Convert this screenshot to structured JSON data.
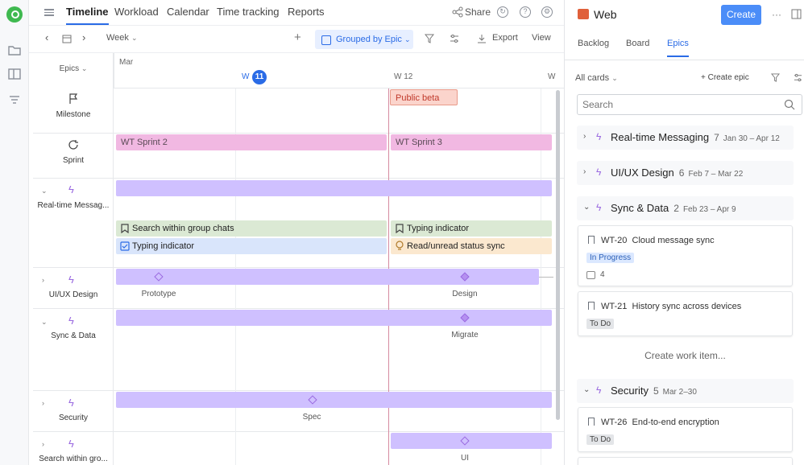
{
  "nav": {
    "tabs": [
      "Timeline",
      "Workload",
      "Calendar",
      "Time tracking",
      "Reports"
    ],
    "active_tab": "Timeline",
    "share": "Share"
  },
  "toolbar": {
    "range": "Week",
    "grouped": "Grouped by Epic",
    "export": "Export",
    "view": "View"
  },
  "timeline": {
    "group_header": "Epics",
    "month": "Mar",
    "weeks": [
      {
        "label": "W",
        "badge": "11"
      },
      {
        "label": "W 12"
      },
      {
        "label": "W"
      }
    ],
    "rows": [
      {
        "label": "Milestone",
        "icon": "flag-icon"
      },
      {
        "label": "Sprint",
        "icon": "sprint-icon"
      },
      {
        "label": "Real-time Messag...",
        "icon": "bolt-icon"
      },
      {
        "label": "UI/UX Design",
        "icon": "bolt-icon"
      },
      {
        "label": "Sync & Data",
        "icon": "bolt-icon"
      },
      {
        "label": "Security",
        "icon": "bolt-icon"
      },
      {
        "label": "Search within gro...",
        "icon": "bolt-icon"
      }
    ],
    "milestone": "Public beta",
    "sprints": [
      "WT Sprint 2",
      "WT Sprint 3"
    ],
    "cards": [
      {
        "title": "Search within group chats",
        "color": "#dbe9d4"
      },
      {
        "title": "Typing indicator",
        "color": "#dbe9d4"
      },
      {
        "title": "Typing indicator",
        "color": "#d9e5fb"
      },
      {
        "title": "Read/unread status sync",
        "color": "#fbe8cf"
      }
    ],
    "markers": [
      "Prototype",
      "Design",
      "Migrate",
      "Spec",
      "UI"
    ]
  },
  "panel": {
    "title": "Web",
    "create": "Create",
    "tabs": [
      "Backlog",
      "Board",
      "Epics"
    ],
    "active_tab": "Epics",
    "filter": "All cards",
    "create_epic": "Create epic",
    "search_placeholder": "Search",
    "groups": [
      {
        "name": "Real-time Messaging",
        "count": "7",
        "dates": "Jan 30 – Apr 12"
      },
      {
        "name": "UI/UX Design",
        "count": "6",
        "dates": "Feb 7 – Mar 22"
      },
      {
        "name": "Sync & Data",
        "count": "2",
        "dates": "Feb 23 – Apr 9"
      },
      {
        "name": "Security",
        "count": "5",
        "dates": "Mar 2–30"
      }
    ],
    "items": [
      {
        "key": "WT-20",
        "title": "Cloud message sync",
        "status": "In Progress",
        "sub": "4"
      },
      {
        "key": "WT-21",
        "title": "History sync across devices",
        "status": "To Do"
      },
      {
        "key": "WT-26",
        "title": "End-to-end encryption",
        "status": "To Do"
      }
    ],
    "create_item": "Create work item..."
  }
}
